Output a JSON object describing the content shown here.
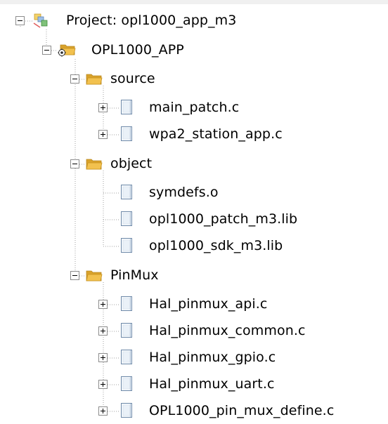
{
  "project": {
    "label": "Project: opl1000_app_m3",
    "icon": "project-icon",
    "expanded": true
  },
  "target": {
    "label": "OPL1000_APP",
    "icon": "target-folder-icon",
    "expanded": true
  },
  "groups": [
    {
      "label": "source",
      "icon": "folder-icon",
      "expanded": true,
      "files": [
        {
          "label": "main_patch.c",
          "icon": "file-icon",
          "expandable": true
        },
        {
          "label": "wpa2_station_app.c",
          "icon": "file-icon",
          "expandable": true
        }
      ]
    },
    {
      "label": "object",
      "icon": "folder-icon",
      "expanded": true,
      "files": [
        {
          "label": "symdefs.o",
          "icon": "file-icon",
          "expandable": false
        },
        {
          "label": "opl1000_patch_m3.lib",
          "icon": "file-icon",
          "expandable": false
        },
        {
          "label": "opl1000_sdk_m3.lib",
          "icon": "file-icon",
          "expandable": false
        }
      ]
    },
    {
      "label": "PinMux",
      "icon": "folder-icon",
      "expanded": true,
      "files": [
        {
          "label": "Hal_pinmux_api.c",
          "icon": "file-icon",
          "expandable": true
        },
        {
          "label": "Hal_pinmux_common.c",
          "icon": "file-icon",
          "expandable": true
        },
        {
          "label": "Hal_pinmux_gpio.c",
          "icon": "file-icon",
          "expandable": true
        },
        {
          "label": "Hal_pinmux_uart.c",
          "icon": "file-icon",
          "expandable": true
        },
        {
          "label": "OPL1000_pin_mux_define.c",
          "icon": "file-icon",
          "expandable": true
        }
      ]
    }
  ],
  "colors": {
    "folder": "#f2c14e",
    "folder_dark": "#d9a22b",
    "toggle_border": "#8c8c8c",
    "dotted_line": "#a0a0a0",
    "file_fill": "#f4f8fc",
    "file_border": "#6e89a8"
  }
}
